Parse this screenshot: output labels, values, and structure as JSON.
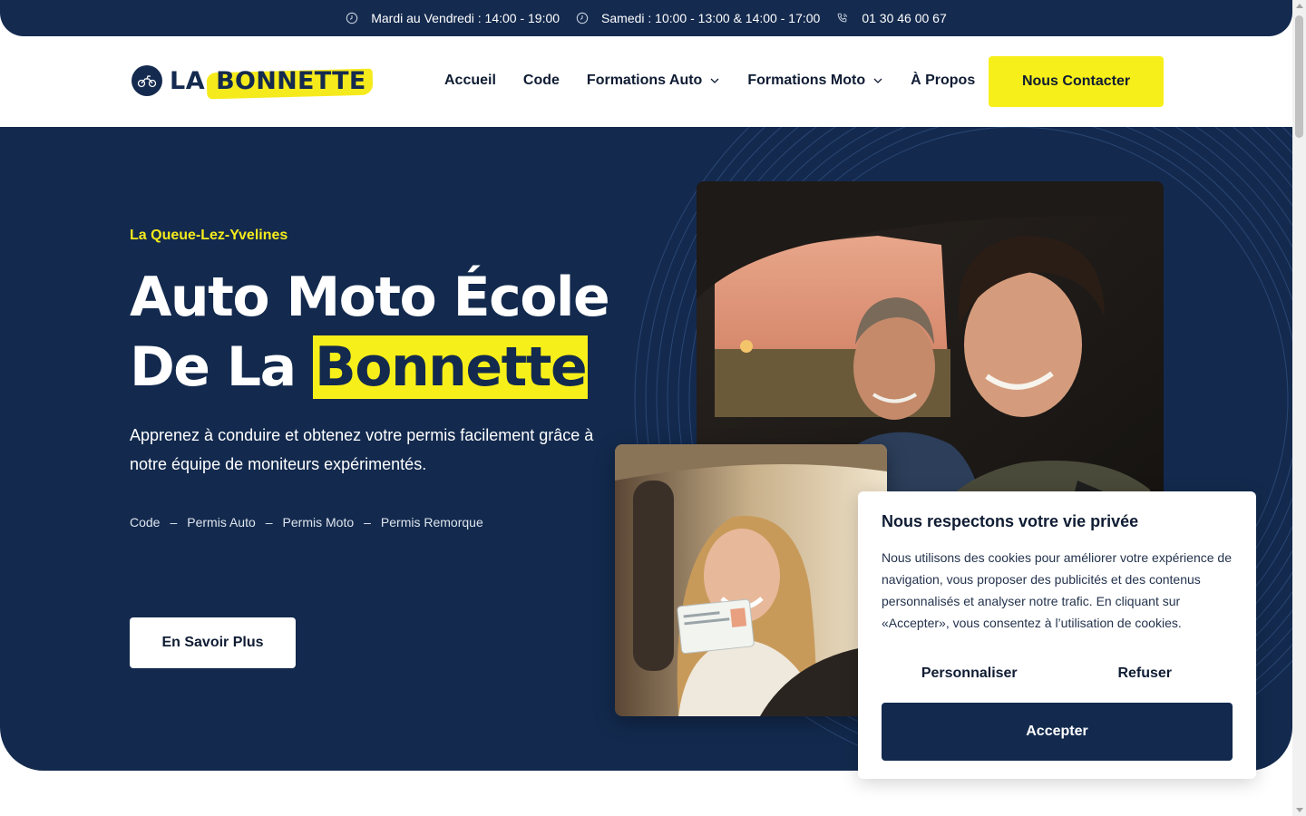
{
  "topbar": {
    "hours_weekdays": "Mardi au Vendredi : 14:00 - 19:00",
    "hours_saturday": "Samedi : 10:00 - 13:00 & 14:00 - 17:00",
    "phone": "01 30 46 00 67",
    "icons": [
      "clock-icon",
      "clock-icon",
      "phone-icon"
    ]
  },
  "logo": {
    "prefix": "LA",
    "name": "BONNETTE"
  },
  "nav": {
    "items": [
      {
        "label": "Accueil",
        "dropdown": false
      },
      {
        "label": "Code",
        "dropdown": false
      },
      {
        "label": "Formations Auto",
        "dropdown": true
      },
      {
        "label": "Formations Moto",
        "dropdown": true
      },
      {
        "label": "À Propos",
        "dropdown": false
      }
    ],
    "cta": "Nous Contacter"
  },
  "hero": {
    "kicker": "La Queue-Lez-Yvelines",
    "title_line1": "Auto Moto École",
    "title_line2_prefix": "De La",
    "title_highlight": "Bonnette",
    "description": "Apprenez à conduire et obtenez votre permis facilement grâce à notre équipe de moniteurs expérimentés.",
    "tags": [
      "Code",
      "Permis Auto",
      "Permis Moto",
      "Permis Remorque"
    ],
    "separator": "–",
    "button": "En Savoir Plus"
  },
  "cookie": {
    "title": "Nous respectons votre vie privée",
    "text": "Nous utilisons des cookies pour améliorer votre expérience de navigation, vous proposer des publicités et des contenus personnalisés et analyser notre trafic. En cliquant sur «Accepter», vous consentez à l’utilisation de cookies.",
    "customize": "Personnaliser",
    "refuse": "Refuser",
    "accept": "Accepter"
  },
  "colors": {
    "navy": "#132a4e",
    "yellow": "#f7ef19",
    "white": "#ffffff"
  }
}
